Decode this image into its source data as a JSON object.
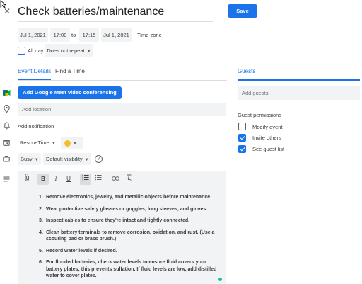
{
  "header": {
    "title": "Check batteries/maintenance",
    "save_label": "Save"
  },
  "datetime": {
    "start_date": "Jul 1, 2021",
    "start_time": "17:00",
    "to": "to",
    "end_time": "17:15",
    "end_date": "Jul 1, 2021",
    "timezone_label": "Time zone",
    "allday_label": "All day",
    "repeat_value": "Does not repeat"
  },
  "tabs": {
    "event_details": "Event Details",
    "find_time": "Find a Time",
    "guests": "Guests"
  },
  "details": {
    "meet_button": "Add Google Meet video conferencing",
    "location_placeholder": "Add location",
    "notification_label": "Add notification",
    "calendar_value": "RescueTime",
    "color_hex": "#f6bf26",
    "busy_value": "Busy",
    "visibility_value": "Default visibility",
    "help_icon": "?"
  },
  "toolbar": {
    "bold": "B",
    "italic": "I",
    "underline": "U"
  },
  "description": {
    "steps": [
      {
        "num": "1.",
        "text": "Remove electronics, jewelry, and metallic objects before maintenance."
      },
      {
        "num": "2.",
        "text": "Wear protective safety glasses or goggles, long sleeves, and gloves."
      },
      {
        "num": "3.",
        "text": "Inspect cables to ensure they're intact and tightly connected."
      },
      {
        "num": "4.",
        "text": "Clean battery terminals to remove corrosion, oxidation, and rust. (Use a scouring pad or brass brush.)"
      },
      {
        "num": "5.",
        "text": "Record water levels if desired."
      },
      {
        "num": "6.",
        "text": "For flooded batteries, check water levels to ensure fluid covers your battery plates; this prevents sulfation. If fluid levels are low, add distilled water to cover plates."
      }
    ]
  },
  "guests": {
    "add_placeholder": "Add guests",
    "permissions_label": "Guest permissions",
    "permissions": [
      {
        "label": "Modify event",
        "checked": false
      },
      {
        "label": "Invite others",
        "checked": true
      },
      {
        "label": "See guest list",
        "checked": true
      }
    ]
  },
  "colors": {
    "accent": "#1a73e8",
    "field_bg": "#f1f3f4"
  }
}
